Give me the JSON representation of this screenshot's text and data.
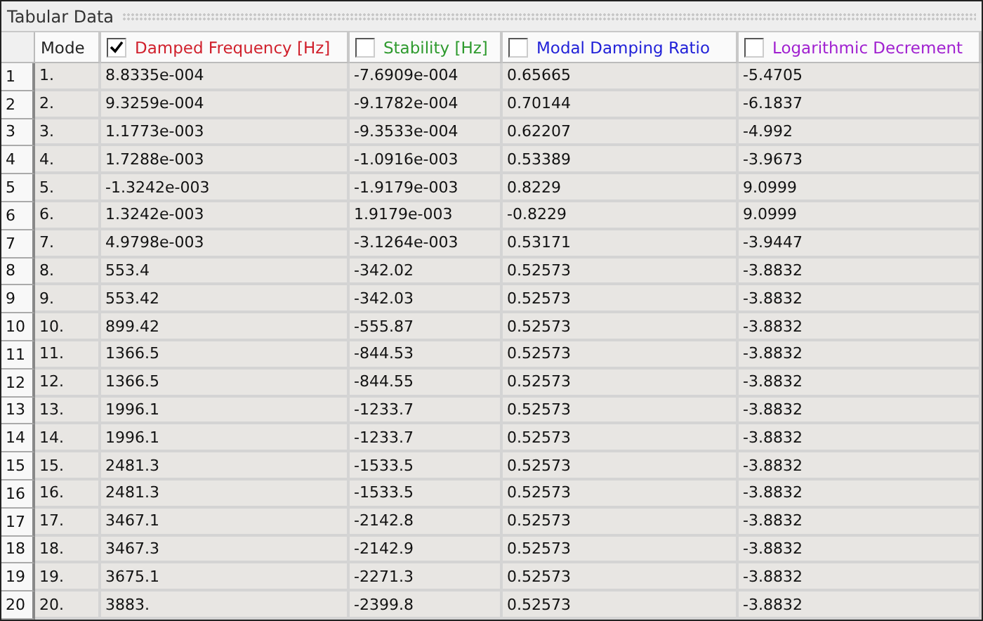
{
  "panel": {
    "title": "Tabular Data"
  },
  "table": {
    "columns": [
      {
        "kind": "plain",
        "label": "Mode"
      },
      {
        "kind": "check",
        "label": "Damped Frequency [Hz]",
        "checked": true,
        "color": "#d0202c"
      },
      {
        "kind": "check",
        "label": "Stability [Hz]",
        "checked": false,
        "color": "#2e9a2e"
      },
      {
        "kind": "check",
        "label": "Modal Damping Ratio",
        "checked": false,
        "color": "#2020d8"
      },
      {
        "kind": "check",
        "label": "Logarithmic Decrement",
        "checked": false,
        "color": "#a020d0"
      }
    ],
    "rows": [
      {
        "index": "1",
        "cells": [
          "1.",
          "8.8335e-004",
          "-7.6909e-004",
          "0.65665",
          "-5.4705"
        ]
      },
      {
        "index": "2",
        "cells": [
          "2.",
          "9.3259e-004",
          "-9.1782e-004",
          "0.70144",
          "-6.1837"
        ]
      },
      {
        "index": "3",
        "cells": [
          "3.",
          "1.1773e-003",
          "-9.3533e-004",
          "0.62207",
          "-4.992"
        ]
      },
      {
        "index": "4",
        "cells": [
          "4.",
          "1.7288e-003",
          "-1.0916e-003",
          "0.53389",
          "-3.9673"
        ]
      },
      {
        "index": "5",
        "cells": [
          "5.",
          "-1.3242e-003",
          "-1.9179e-003",
          "0.8229",
          "9.0999"
        ]
      },
      {
        "index": "6",
        "cells": [
          "6.",
          "1.3242e-003",
          "1.9179e-003",
          "-0.8229",
          "9.0999"
        ]
      },
      {
        "index": "7",
        "cells": [
          "7.",
          "4.9798e-003",
          "-3.1264e-003",
          "0.53171",
          "-3.9447"
        ]
      },
      {
        "index": "8",
        "cells": [
          "8.",
          "553.4",
          "-342.02",
          "0.52573",
          "-3.8832"
        ]
      },
      {
        "index": "9",
        "cells": [
          "9.",
          "553.42",
          "-342.03",
          "0.52573",
          "-3.8832"
        ]
      },
      {
        "index": "10",
        "cells": [
          "10.",
          "899.42",
          "-555.87",
          "0.52573",
          "-3.8832"
        ]
      },
      {
        "index": "11",
        "cells": [
          "11.",
          "1366.5",
          "-844.53",
          "0.52573",
          "-3.8832"
        ]
      },
      {
        "index": "12",
        "cells": [
          "12.",
          "1366.5",
          "-844.55",
          "0.52573",
          "-3.8832"
        ]
      },
      {
        "index": "13",
        "cells": [
          "13.",
          "1996.1",
          "-1233.7",
          "0.52573",
          "-3.8832"
        ]
      },
      {
        "index": "14",
        "cells": [
          "14.",
          "1996.1",
          "-1233.7",
          "0.52573",
          "-3.8832"
        ]
      },
      {
        "index": "15",
        "cells": [
          "15.",
          "2481.3",
          "-1533.5",
          "0.52573",
          "-3.8832"
        ]
      },
      {
        "index": "16",
        "cells": [
          "16.",
          "2481.3",
          "-1533.5",
          "0.52573",
          "-3.8832"
        ]
      },
      {
        "index": "17",
        "cells": [
          "17.",
          "3467.1",
          "-2142.8",
          "0.52573",
          "-3.8832"
        ]
      },
      {
        "index": "18",
        "cells": [
          "18.",
          "3467.3",
          "-2142.9",
          "0.52573",
          "-3.8832"
        ]
      },
      {
        "index": "19",
        "cells": [
          "19.",
          "3675.1",
          "-2271.3",
          "0.52573",
          "-3.8832"
        ]
      },
      {
        "index": "20",
        "cells": [
          "20.",
          "3883.",
          "-2399.8",
          "0.52573",
          "-3.8832"
        ]
      }
    ]
  }
}
